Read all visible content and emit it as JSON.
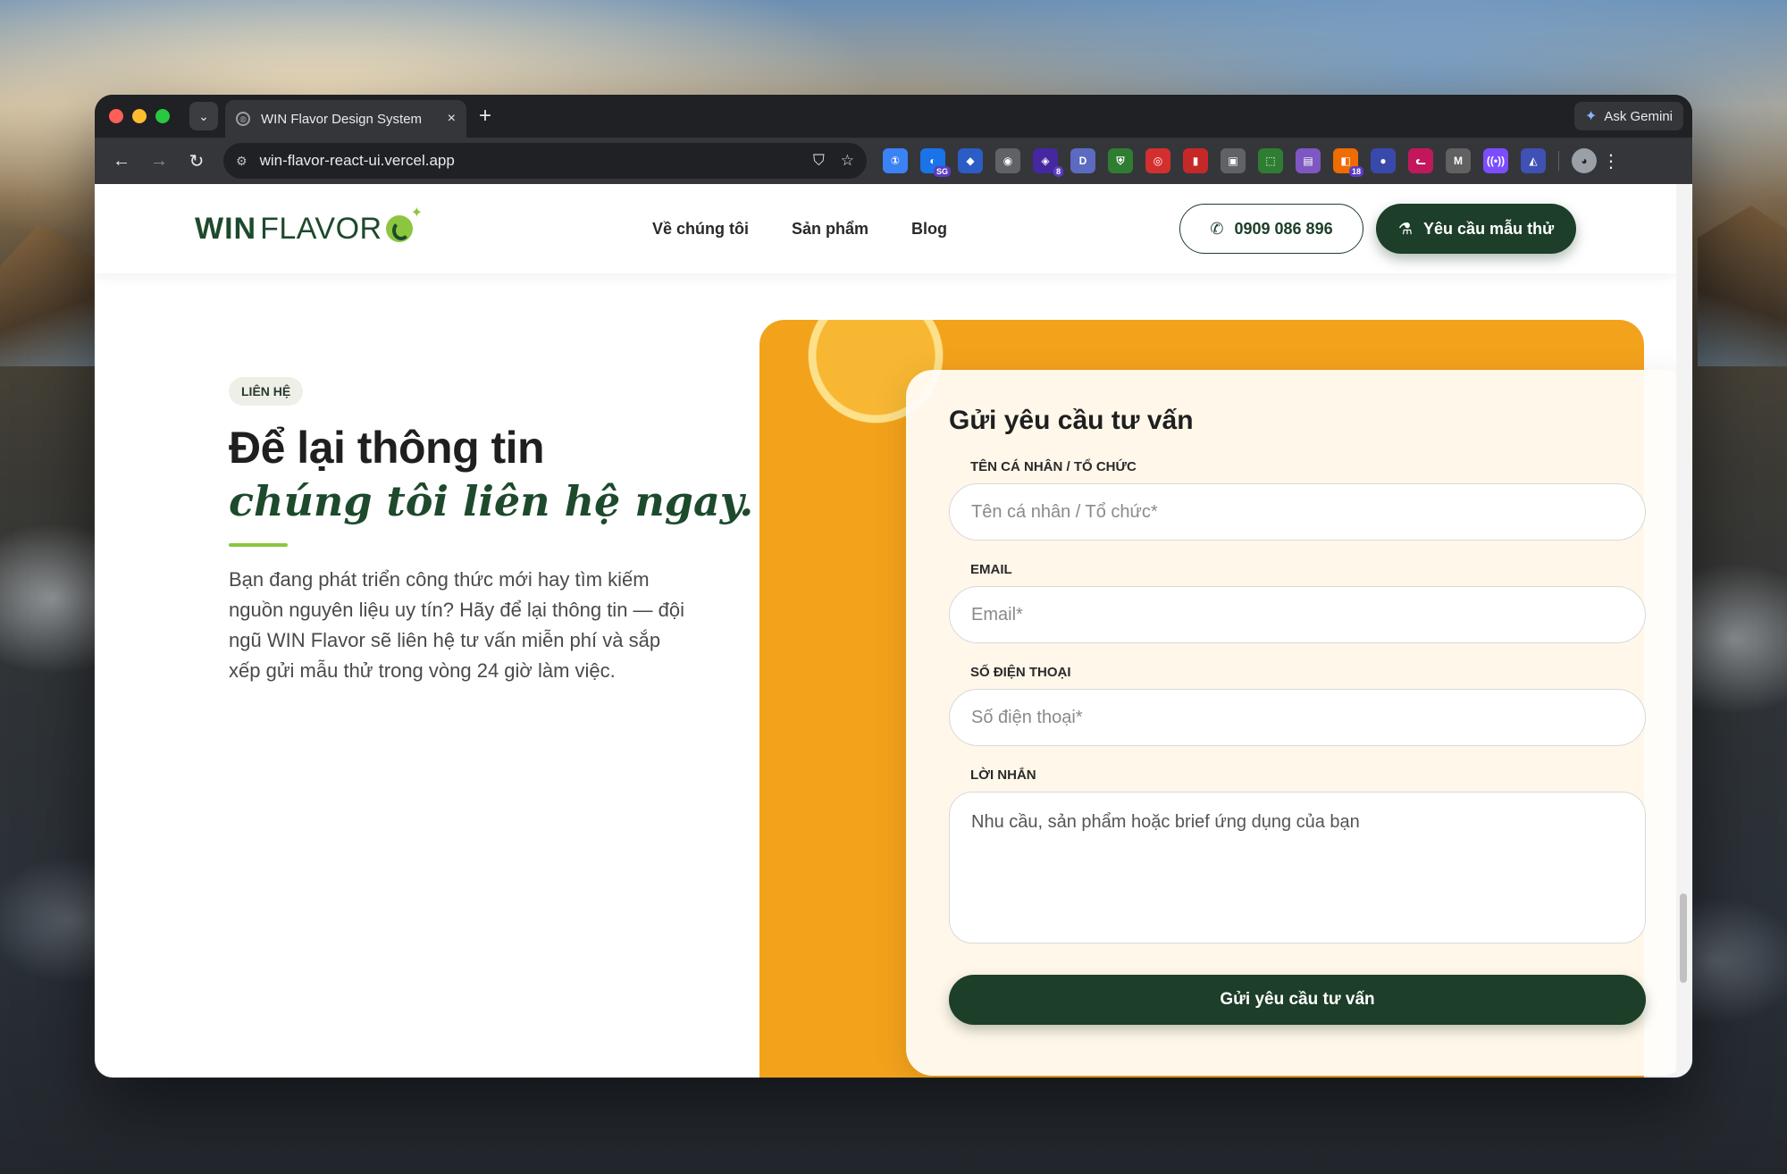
{
  "browser": {
    "tab_title": "WIN Flavor Design System",
    "tab_close": "×",
    "new_tab": "+",
    "gemini_label": "Ask Gemini",
    "url": "win-flavor-react-ui.vercel.app",
    "extensions": [
      {
        "icon": "1password-icon",
        "color": "#3b82f6",
        "glyph": "①",
        "badge": ""
      },
      {
        "icon": "sg-extension-icon",
        "color": "#1a73e8",
        "glyph": "◐",
        "badge": "SG"
      },
      {
        "icon": "diamond-icon",
        "color": "#2c5cc5",
        "glyph": "◆",
        "badge": ""
      },
      {
        "icon": "camera-icon",
        "color": "#5f6368",
        "glyph": "◉",
        "badge": ""
      },
      {
        "icon": "dice-icon",
        "color": "#4527a0",
        "glyph": "◈",
        "badge": "8"
      },
      {
        "icon": "d-extension-icon",
        "color": "#5c6bc0",
        "glyph": "D",
        "badge": ""
      },
      {
        "icon": "shield-icon",
        "color": "#2e7d32",
        "glyph": "⛨",
        "badge": ""
      },
      {
        "icon": "target-icon",
        "color": "#d32f2f",
        "glyph": "◎",
        "badge": ""
      },
      {
        "icon": "bookmark-icon",
        "color": "#c62828",
        "glyph": "▮",
        "badge": ""
      },
      {
        "icon": "window-star-icon",
        "color": "#5f6368",
        "glyph": "▣",
        "badge": ""
      },
      {
        "icon": "crop-icon",
        "color": "#2e7d32",
        "glyph": "⬚",
        "badge": ""
      },
      {
        "icon": "purple-box-icon",
        "color": "#7e57c2",
        "glyph": "▤",
        "badge": ""
      },
      {
        "icon": "stack-icon",
        "color": "#ef6c00",
        "glyph": "◧",
        "badge": "18"
      },
      {
        "icon": "blue-circle-icon",
        "color": "#3949ab",
        "glyph": "●",
        "badge": ""
      },
      {
        "icon": "cat-icon",
        "color": "#c2185b",
        "glyph": "ᓚ",
        "badge": ""
      },
      {
        "icon": "m-extension-icon",
        "color": "#616161",
        "glyph": "M",
        "badge": ""
      },
      {
        "icon": "broadcast-icon",
        "color": "#7c4dff",
        "glyph": "((•))",
        "badge": ""
      },
      {
        "icon": "tag-icon",
        "color": "#3f51b5",
        "glyph": "◭",
        "badge": ""
      }
    ]
  },
  "header": {
    "logo_win": "WIN",
    "logo_flavor": "FLAVOR",
    "nav": [
      "Về chúng tôi",
      "Sản phẩm",
      "Blog"
    ],
    "phone": "0909 086 896",
    "sample_cta": "Yêu cầu mẫu thử"
  },
  "contact": {
    "chip": "LIÊN HỆ",
    "heading_line1": "Để lại thông tin",
    "heading_line2": "chúng tôi liên hệ ngay.",
    "intro": "Bạn đang phát triển công thức mới hay tìm kiếm nguồn nguyên liệu uy tín? Hãy để lại thông tin — đội ngũ WIN Flavor sẽ liên hệ tư vấn miễn phí và sắp xếp gửi mẫu thử trong vòng 24 giờ làm việc."
  },
  "form": {
    "title": "Gửi yêu cầu tư vấn",
    "name_label": "TÊN CÁ NHÂN / TỔ CHỨC",
    "name_placeholder": "Tên cá nhân / Tổ chức*",
    "email_label": "EMAIL",
    "email_placeholder": "Email*",
    "phone_label": "SỐ ĐIỆN THOẠI",
    "phone_placeholder": "Số điện thoại*",
    "message_label": "LỜI NHẮN",
    "message_placeholder": "Nhu cầu, sản phẩm hoặc brief ứng dụng của bạn",
    "submit": "Gửi yêu cầu tư vấn"
  }
}
